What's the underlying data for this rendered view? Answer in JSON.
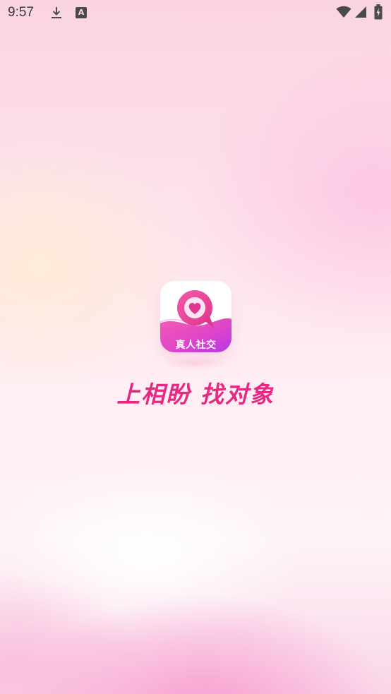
{
  "status_bar": {
    "time": "9:57",
    "notification_icons": [
      "download-icon",
      "text-a-icon"
    ],
    "notification_badge_letter": "A",
    "system_icons": [
      "wifi-icon",
      "signal-icon",
      "battery-charging-icon"
    ]
  },
  "splash": {
    "logo_label": "真人社交",
    "slogan": "上相盼 找对象"
  },
  "colors": {
    "brand_pink": "#e62a83",
    "logo_gradient_start": "#f45bb4",
    "logo_gradient_end": "#b43ae6"
  }
}
